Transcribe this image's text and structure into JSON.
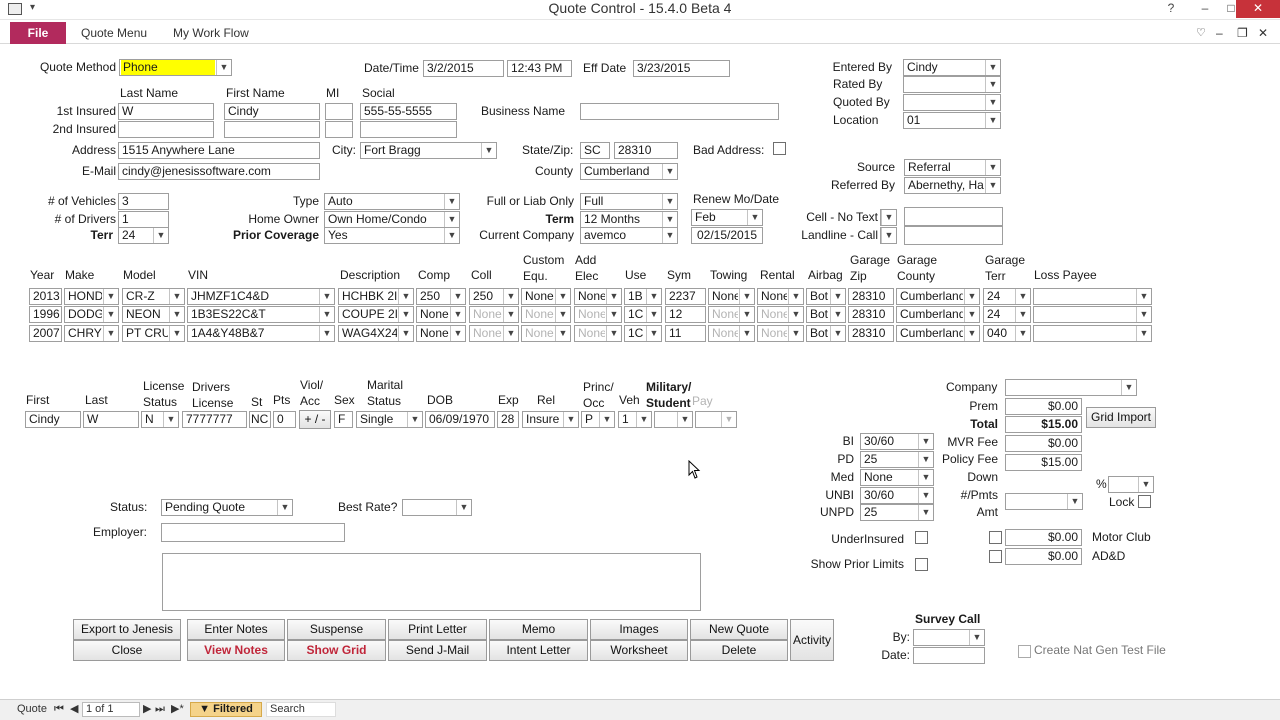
{
  "window": {
    "title": "Quote Control  -  15.4.0 Beta 4"
  },
  "ribbon": {
    "file": "File",
    "tabs": [
      "Quote Menu",
      "My Work Flow"
    ]
  },
  "labels": {
    "quote_method": "Quote Method",
    "last_name": "Last Name",
    "first_name": "First Name",
    "mi": "MI",
    "social": "Social",
    "first_insured": "1st Insured",
    "second_insured": "2nd Insured",
    "address": "Address",
    "email": "E-Mail",
    "date_time": "Date/Time",
    "eff_date": "Eff Date",
    "business_name": "Business  Name",
    "city": "City:",
    "state_zip": "State/Zip:",
    "bad_address": "Bad Address:",
    "county": "County",
    "entered_by": "Entered By",
    "rated_by": "Rated By",
    "quoted_by": "Quoted By",
    "location": "Location",
    "source": "Source",
    "referred_by": "Referred By",
    "num_vehicles": "# of Vehicles",
    "num_drivers": "# of Drivers",
    "terr": "Terr",
    "type": "Type",
    "home_owner": "Home Owner",
    "prior_coverage": "Prior Coverage",
    "full_liab": "Full or Liab Only",
    "term": "Term",
    "current_company": "Current Company",
    "renew": "Renew Mo/Date",
    "cell_no_text": "Cell - No Text",
    "landline_call": "Landline - Call",
    "status": "Status:",
    "best_rate": "Best Rate?",
    "employer": "Employer:",
    "bi": "BI",
    "pd": "PD",
    "med": "Med",
    "unbi": "UNBI",
    "unpd": "UNPD",
    "underinsured": "UnderInsured",
    "show_prior_limits": "Show Prior Limits",
    "company": "Company",
    "prem": "Prem",
    "total": "Total",
    "mvr_fee": "MVR Fee",
    "policy_fee": "Policy Fee",
    "down": "Down",
    "num_pmts": "#/Pmts",
    "amt": "Amt",
    "pct": "%",
    "lock": "Lock",
    "motor_club": "Motor Club",
    "add": "AD&D",
    "survey_call": "Survey Call",
    "by": "By:",
    "date": "Date:",
    "create_nat_gen": "Create Nat Gen Test File"
  },
  "client": {
    "quote_method": "Phone",
    "date": "3/2/2015",
    "time": "12:43 PM",
    "eff_date": "3/23/2015",
    "insured1": {
      "last": "W",
      "first": "Cindy",
      "mi": "",
      "social": "555-55-5555"
    },
    "insured2": {
      "last": "",
      "first": "",
      "mi": "",
      "social": ""
    },
    "business_name": "",
    "address": "1515 Anywhere Lane",
    "city": "Fort Bragg",
    "state": "SC",
    "zip": "28310",
    "email": "cindy@jenesissoftware.com",
    "county": "Cumberland",
    "entered_by": "Cindy",
    "rated_by": "",
    "quoted_by": "",
    "location": "01",
    "source": "Referral",
    "referred_by": "Abernethy, Hai",
    "num_vehicles": "3",
    "num_drivers": "1",
    "terr": "24",
    "type": "Auto",
    "home_owner": "Own Home/Condo",
    "prior_coverage": "Yes",
    "full_liab": "Full",
    "term": "12 Months",
    "current_company": "avemco",
    "renew_month": "Feb",
    "renew_date": "02/15/2015",
    "cell": "",
    "landline": ""
  },
  "vehicle_headers": {
    "year": "Year",
    "make": "Make",
    "model": "Model",
    "vin": "VIN",
    "description": "Description",
    "comp": "Comp",
    "coll": "Coll",
    "custom_equ": [
      "Custom",
      "Equ."
    ],
    "add_elec": [
      "Add",
      "Elec"
    ],
    "use": "Use",
    "sym": "Sym",
    "towing": "Towing",
    "rental": "Rental",
    "airbag": "Airbag",
    "garage_zip": [
      "Garage",
      "Zip"
    ],
    "garage_county": [
      "Garage",
      "County"
    ],
    "garage_terr": [
      "Garage",
      "Terr"
    ],
    "loss_payee": "Loss Payee"
  },
  "vehicles": [
    {
      "year": "2013",
      "make": "HOND",
      "model": "CR-Z",
      "vin": "JHMZF1C4&D",
      "desc": "HCHBK 2I",
      "comp": "250",
      "coll": "250",
      "custom": "None",
      "elec": "None",
      "use": "1B",
      "sym": "2237",
      "towing": "None",
      "rental": "None",
      "airbag": "Bot",
      "gzip": "28310",
      "gcounty": "Cumberland",
      "gterr": "24",
      "loss": ""
    },
    {
      "year": "1996",
      "make": "DODG",
      "model": "NEON",
      "vin": "1B3ES22C&T",
      "desc": "COUPE 2I",
      "comp": "None",
      "coll": "None",
      "custom": "None",
      "elec": "None",
      "use": "1C",
      "sym": "12",
      "towing": "None",
      "rental": "None",
      "airbag": "Bot",
      "gzip": "28310",
      "gcounty": "Cumberland",
      "gterr": "24",
      "loss": ""
    },
    {
      "year": "2007",
      "make": "CHRY",
      "model": "PT CRU",
      "vin": "1A4&Y48B&7",
      "desc": "WAG4X24",
      "comp": "None",
      "coll": "None",
      "custom": "None",
      "elec": "None",
      "use": "1C",
      "sym": "11",
      "towing": "None",
      "rental": "None",
      "airbag": "Bot",
      "gzip": "28310",
      "gcounty": "Cumberland",
      "gterr": "040",
      "loss": ""
    }
  ],
  "driver_headers": {
    "first": "First",
    "last": "Last",
    "license_status": [
      "License",
      "Status"
    ],
    "drivers_license": [
      "Drivers",
      "License"
    ],
    "st": "St",
    "pts": "Pts",
    "viol_acc": [
      "Viol/",
      "Acc"
    ],
    "sex": "Sex",
    "marital_status": [
      "Marital",
      "Status"
    ],
    "dob": "DOB",
    "exp": "Exp",
    "rel": "Rel",
    "princ_occ": [
      "Princ/",
      "Occ"
    ],
    "veh": "Veh",
    "military": [
      "Military/",
      "Student"
    ],
    "pay": "Pay"
  },
  "driver": {
    "first": "Cindy",
    "last": "W",
    "license_status": "N",
    "license": "7777777",
    "st": "NC",
    "pts": "0",
    "viol": "+ / -",
    "sex": "F",
    "marital": "Single",
    "dob": "06/09/1970",
    "exp": "28",
    "rel": "Insure",
    "princ": "P",
    "veh": "1",
    "military": "",
    "pay": ""
  },
  "quote": {
    "status": "Pending Quote",
    "best_rate": "",
    "employer": "",
    "notes": ""
  },
  "coverage": {
    "bi": "30/60",
    "pd": "25",
    "med": "None",
    "unbi": "30/60",
    "unpd": "25"
  },
  "premium": {
    "company": "",
    "prem": "$0.00",
    "total": "$15.00",
    "mvr_fee": "$0.00",
    "policy_fee": "$15.00",
    "down": "",
    "num_pmts": "",
    "amt": "",
    "pct": "",
    "motor_club": "$0.00",
    "add": "$0.00",
    "grid_import": "Grid Import"
  },
  "buttons": {
    "row1": [
      "Export to Jenesis",
      "Enter Notes",
      "Suspense",
      "Print Letter",
      "Memo",
      "Images",
      "New Quote"
    ],
    "row2": [
      "Close",
      "View Notes",
      "Show Grid",
      "Send J-Mail",
      "Intent Letter",
      "Worksheet",
      "Delete"
    ],
    "activity": "Activity"
  },
  "survey": {
    "by": "",
    "date": ""
  },
  "statusbar": {
    "record_label": "Quote",
    "record": "1 of 1",
    "filtered": "Filtered",
    "search": "Search"
  }
}
